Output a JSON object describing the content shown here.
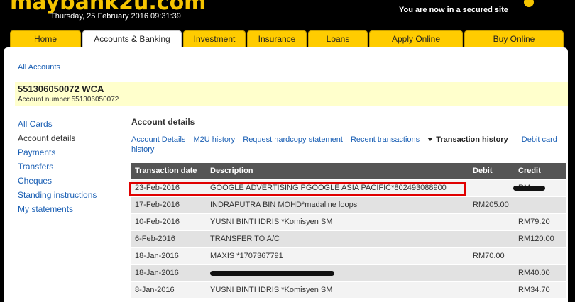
{
  "header": {
    "logo": "maybank2u.com",
    "datetime": "Thursday, 25 February 2016 09:31:39",
    "secure_text": "You are now in a secured site"
  },
  "nav": {
    "tabs": [
      "Home",
      "Accounts & Banking",
      "Investment",
      "Insurance",
      "Loans",
      "Apply Online",
      "Buy Online"
    ],
    "active": "Accounts & Banking"
  },
  "breadcrumb": "All Accounts",
  "account": {
    "title": "551306050072 WCA",
    "subtitle": "Account number 551306050072"
  },
  "sidebar": {
    "items": [
      "All Cards",
      "Account details",
      "Payments",
      "Transfers",
      "Cheques",
      "Standing instructions",
      "My statements"
    ]
  },
  "main": {
    "section_title": "Account details",
    "links": [
      "Account Details",
      "M2U history",
      "Request hardcopy statement",
      "Recent transactions",
      "Transaction history",
      "Debit card history"
    ],
    "current_link": "Transaction history"
  },
  "table": {
    "headers": [
      "Transaction date",
      "Description",
      "Debit",
      "Credit"
    ],
    "rows": [
      {
        "date": "23-Feb-2016",
        "desc": "GOOGLE ADVERTISING PGOOGLE ASIA PACIFIC*802493088900",
        "debit": "",
        "credit": "RM"
      },
      {
        "date": "17-Feb-2016",
        "desc": "INDRAPUTRA BIN MOHD*madaline loops",
        "debit": "RM205.00",
        "credit": ""
      },
      {
        "date": "10-Feb-2016",
        "desc": "YUSNI BINTI IDRIS *Komisyen SM",
        "debit": "",
        "credit": "RM79.20"
      },
      {
        "date": "6-Feb-2016",
        "desc": "TRANSFER TO A/C",
        "debit": "",
        "credit": "RM120.00"
      },
      {
        "date": "18-Jan-2016",
        "desc": "MAXIS *1707367791",
        "debit": "RM70.00",
        "credit": ""
      },
      {
        "date": "18-Jan-2016",
        "desc": "",
        "debit": "",
        "credit": "RM40.00"
      },
      {
        "date": "8-Jan-2016",
        "desc": "YUSNI BINTI IDRIS *Komisyen SM",
        "debit": "",
        "credit": "RM34.70"
      }
    ]
  },
  "colors": {
    "brand_yellow": "#ffcc00",
    "highlight_red": "#e00000",
    "link_blue": "#1a5fb4"
  }
}
